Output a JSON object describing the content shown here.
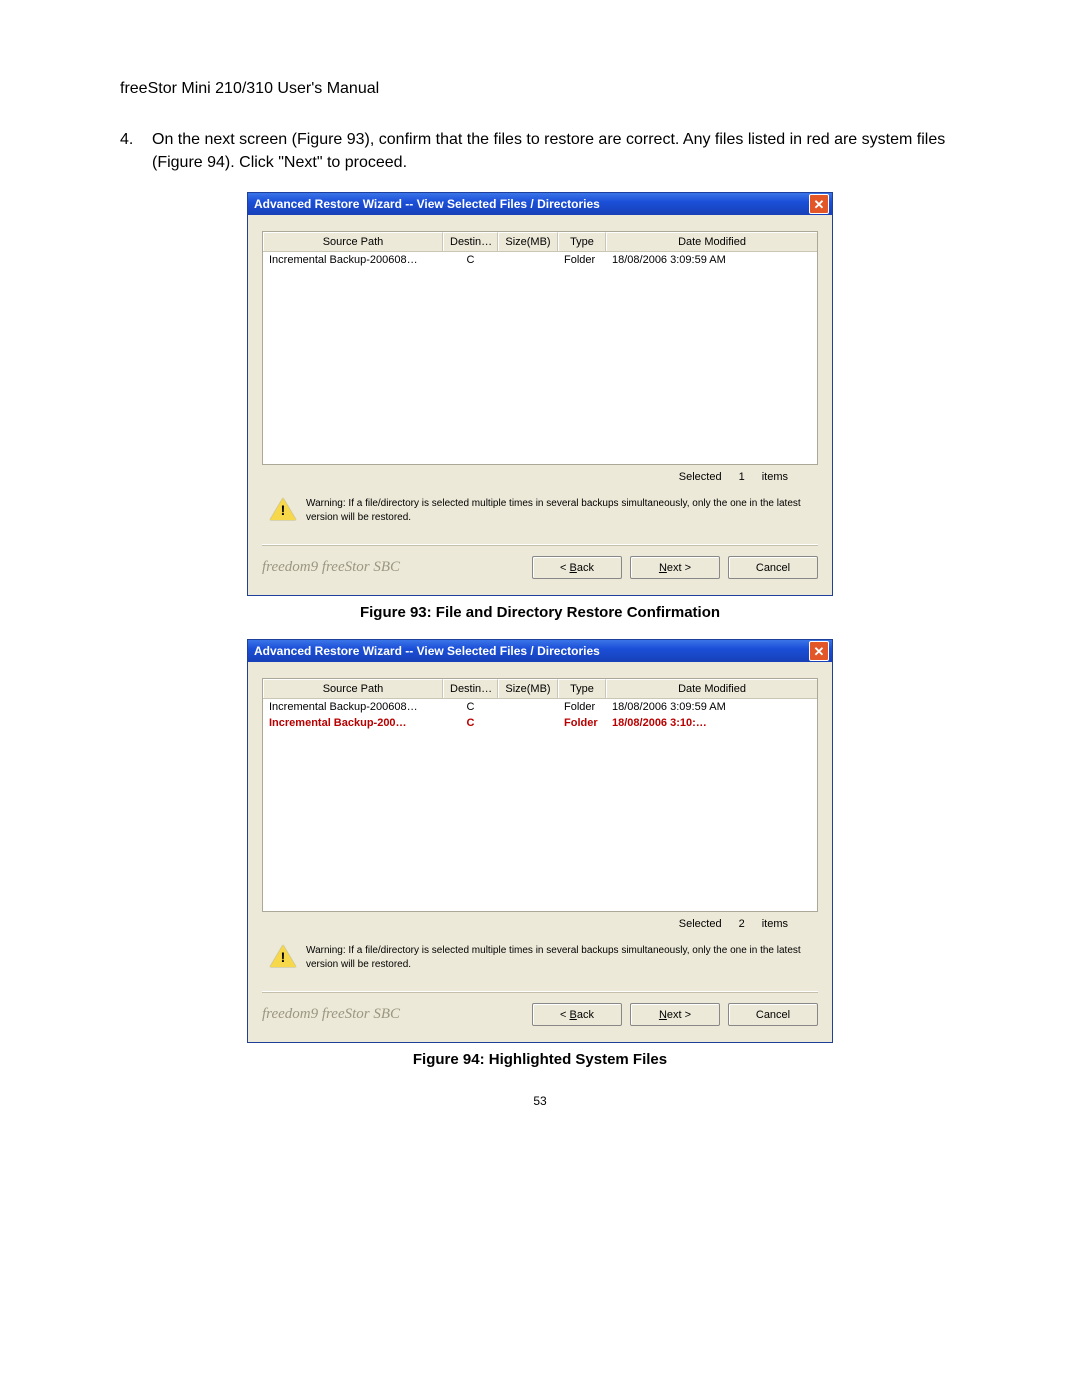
{
  "manual_title": "freeStor Mini 210/310 User's Manual",
  "step_number": "4.",
  "step_text": "On the next screen (Figure 93), confirm that the files to restore are correct.  Any files listed in red are system files (Figure 94).  Click \"Next\" to proceed.",
  "page_number": "53",
  "dialog1": {
    "title": "Advanced Restore Wizard -- View Selected Files / Directories",
    "columns": {
      "source_path": "Source Path",
      "destin": "Destin…",
      "size_mb": "Size(MB)",
      "type": "Type",
      "date_modified": "Date Modified"
    },
    "rows": [
      {
        "sp": "Incremental Backup-200608…",
        "de": "C",
        "sz": "",
        "ty": "Folder",
        "dm": "18/08/2006 3:09:59 AM",
        "red": false
      }
    ],
    "selected_label": "Selected",
    "selected_count": "1",
    "items_label": "items",
    "warning": "Warning: If a file/directory is selected multiple times in several backups simultaneously, only the one in the latest version will be restored.",
    "brand": "freedom9 freeStor SBC",
    "btn_back": "< Back",
    "btn_next": "Next >",
    "btn_cancel": "Cancel",
    "caption": "Figure 93: File and Directory Restore Confirmation"
  },
  "dialog2": {
    "title": "Advanced Restore Wizard -- View Selected Files / Directories",
    "columns": {
      "source_path": "Source Path",
      "destin": "Destin…",
      "size_mb": "Size(MB)",
      "type": "Type",
      "date_modified": "Date Modified"
    },
    "rows": [
      {
        "sp": "Incremental Backup-200608…",
        "de": "C",
        "sz": "",
        "ty": "Folder",
        "dm": "18/08/2006 3:09:59 AM",
        "red": false
      },
      {
        "sp": "Incremental Backup-200…",
        "de": "C",
        "sz": "",
        "ty": "Folder",
        "dm": "18/08/2006 3:10:…",
        "red": true
      }
    ],
    "selected_label": "Selected",
    "selected_count": "2",
    "items_label": "items",
    "warning": "Warning: If a file/directory is selected multiple times in several backups simultaneously, only the one in the latest version will be restored.",
    "brand": "freedom9 freeStor SBC",
    "btn_back": "< Back",
    "btn_next": "Next >",
    "btn_cancel": "Cancel",
    "caption": "Figure 94: Highlighted System Files"
  }
}
